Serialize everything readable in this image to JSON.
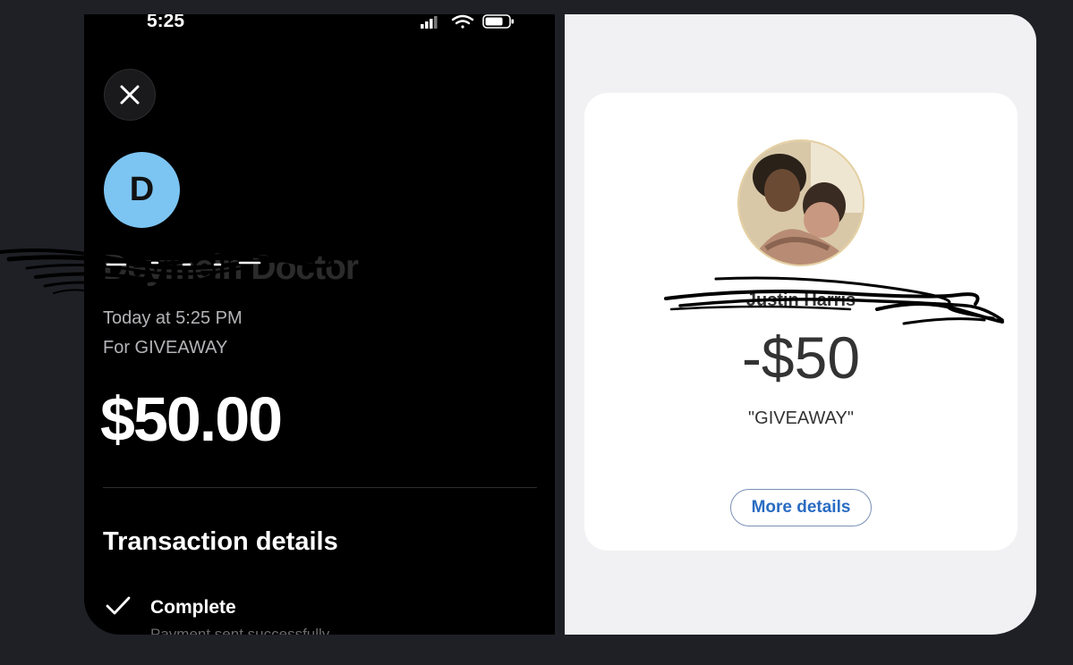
{
  "left_screen": {
    "status_bar": {
      "time": "5:25",
      "icons": [
        "cellular-signal-icon",
        "wifi-icon",
        "battery-icon"
      ]
    },
    "close_icon": "close-icon",
    "avatar_initial": "D",
    "avatar_color": "#7cc4f2",
    "recipient_name": "Deymein Doctor",
    "date_line": "Today at 5:25 PM",
    "note_line": "For GIVEAWAY",
    "amount": "$50.00",
    "section_title": "Transaction details",
    "status": {
      "icon": "checkmark-icon",
      "label": "Complete",
      "sublabel": "Payment sent successfully"
    }
  },
  "right_screen": {
    "recipient_name": "Justin Harris",
    "amount": "-$50",
    "memo": "\"GIVEAWAY\"",
    "more_details_button": "More details",
    "button_color": "#2a6cc2"
  }
}
